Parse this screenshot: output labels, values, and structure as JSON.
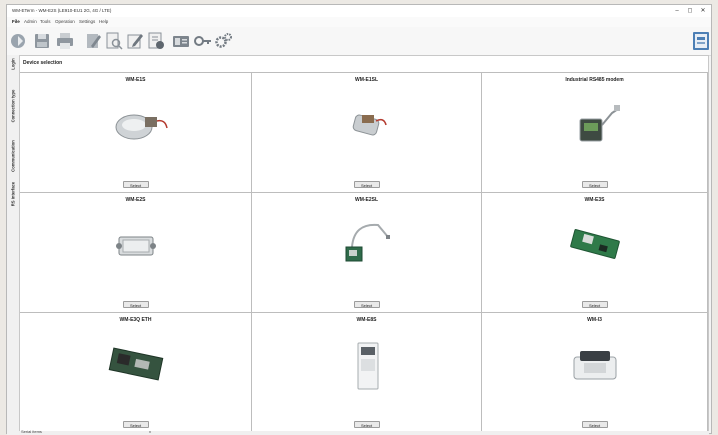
{
  "window": {
    "title": "WM-ETerm - WM-E2S (LE910-EU1 2G, 4G / LTE)",
    "controls": [
      "–",
      "◻",
      "✕"
    ]
  },
  "menu": [
    "File",
    "Admin",
    "Tools",
    "Operation",
    "Settings",
    "Help"
  ],
  "toolbar": {
    "icons": [
      "connect-icon",
      "save-icon",
      "print-icon",
      "edit-doc-icon",
      "preview-icon",
      "edit-icon",
      "report-icon",
      "id-card-icon",
      "key-icon",
      "settings-icon",
      "device-icon"
    ]
  },
  "sidebar": {
    "tabs": [
      "Login",
      "Connection type",
      "Communication",
      "RS interface"
    ]
  },
  "main": {
    "section_title": "Device selection",
    "select_label": "Select",
    "devices": [
      {
        "name": "WM-E1S"
      },
      {
        "name": "WM-E1SL"
      },
      {
        "name": "Industrial RS485 modem"
      },
      {
        "name": "WM-E2S"
      },
      {
        "name": "WM-E2SL"
      },
      {
        "name": "WM-E3S"
      },
      {
        "name": "WM-E3Q ETH"
      },
      {
        "name": "WM-E8S"
      },
      {
        "name": "WM-I3"
      }
    ]
  },
  "status": {
    "left": "Serial items",
    "mark": "x"
  }
}
